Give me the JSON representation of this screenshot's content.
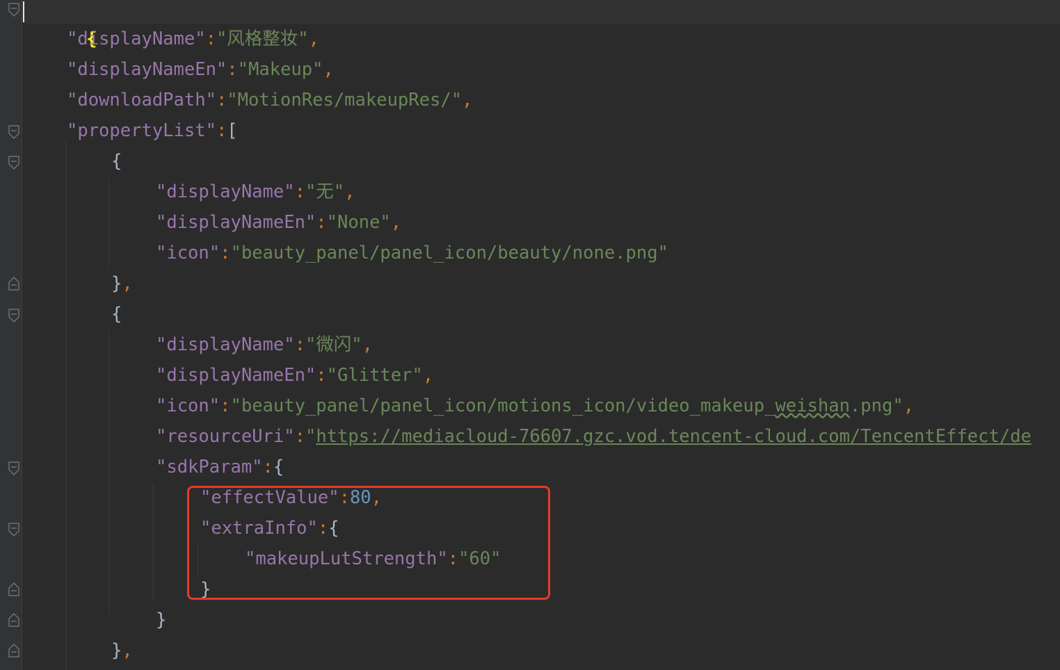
{
  "editor": {
    "lines": [
      {
        "key": "{"
      },
      {
        "key": "\"displayName\"",
        "colon": ":",
        "value": "\"风格整妆\"",
        "comma": ","
      },
      {
        "key": "\"displayNameEn\"",
        "colon": ":",
        "value": "\"Makeup\"",
        "comma": ","
      },
      {
        "key": "\"downloadPath\"",
        "colon": ":",
        "value": "\"MotionRes/makeupRes/\"",
        "comma": ","
      },
      {
        "key": "\"propertyList\"",
        "colon": ":",
        "open": "["
      },
      {
        "open": "{"
      },
      {
        "key": "\"displayName\"",
        "colon": ":",
        "value": "\"无\"",
        "comma": ","
      },
      {
        "key": "\"displayNameEn\"",
        "colon": ":",
        "value": "\"None\"",
        "comma": ","
      },
      {
        "key": "\"icon\"",
        "colon": ":",
        "value": "\"beauty_panel/panel_icon/beauty/none.png\""
      },
      {
        "close": "}",
        "comma": ","
      },
      {
        "open": "{"
      },
      {
        "key": "\"displayName\"",
        "colon": ":",
        "value": "\"微闪\"",
        "comma": ","
      },
      {
        "key": "\"displayNameEn\"",
        "colon": ":",
        "value": "\"Glitter\"",
        "comma": ","
      },
      {
        "key": "\"icon\"",
        "colon": ":",
        "value_a": "\"beauty_panel/panel_icon/motions_icon/video_makeup_",
        "value_typo": "weishan",
        "value_b": ".png\"",
        "comma": ","
      },
      {
        "key": "\"resourceUri\"",
        "colon": ":",
        "quote": "\"",
        "url": "https://mediacloud-76607.gzc.vod.tencent-cloud.com/TencentEffect/de"
      },
      {
        "key": "\"sdkParam\"",
        "colon": ":",
        "open": "{"
      },
      {
        "key": "\"effectValue\"",
        "colon": ":",
        "number": "80",
        "comma": ","
      },
      {
        "key": "\"extraInfo\"",
        "colon": ":",
        "open": "{"
      },
      {
        "key": "\"makeupLutStrength\"",
        "colon": ":",
        "value": "\"60\""
      },
      {
        "close": "}"
      },
      {
        "close": "}"
      },
      {
        "close": "}",
        "comma": ","
      }
    ]
  },
  "colors": {
    "background": "#2b2b2b",
    "key": "#9876aa",
    "string": "#6a8759",
    "number": "#6897bb",
    "punctuation": "#a9b7c6",
    "comma": "#cc7832",
    "annotation_box": "#e53a2c"
  }
}
